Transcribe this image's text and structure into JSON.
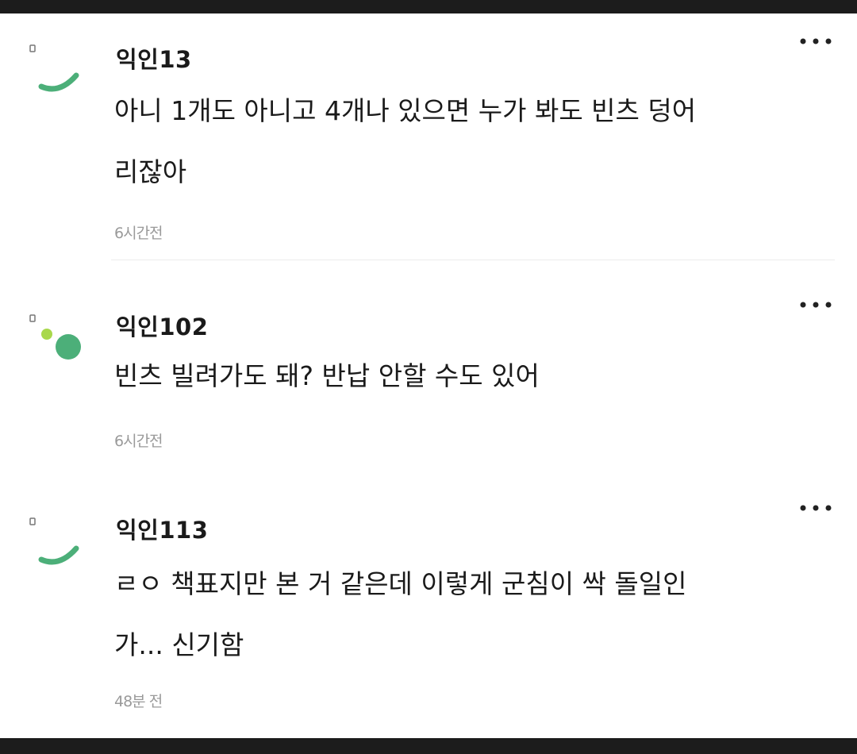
{
  "comments": [
    {
      "nickname": "익인13",
      "text_lines": [
        "아니 1개도 아니고 4개나 있으면 누가 봐도 빈츠 덩어",
        "리잖아"
      ],
      "time": "6시간전",
      "avatar": "arc-avatar-icon"
    },
    {
      "nickname": "익인102",
      "text_lines": [
        "빈츠 빌려가도 돼? 반납 안할 수도 있어"
      ],
      "time": "6시간전",
      "avatar": "dots-avatar-icon"
    },
    {
      "nickname": "익인113",
      "text_lines": [
        "ㄹㅇ 책표지만 본 거 같은데 이렇게 군침이 싹 돌일인",
        "가... 신기함"
      ],
      "time": "48분 전",
      "avatar": "arc-avatar-icon"
    }
  ],
  "more_icon": "more-options-icon",
  "colors": {
    "accent_green": "#4caf79",
    "accent_lime": "#a8d84b",
    "text": "#1a1a1a",
    "muted": "#9a9a9a"
  }
}
